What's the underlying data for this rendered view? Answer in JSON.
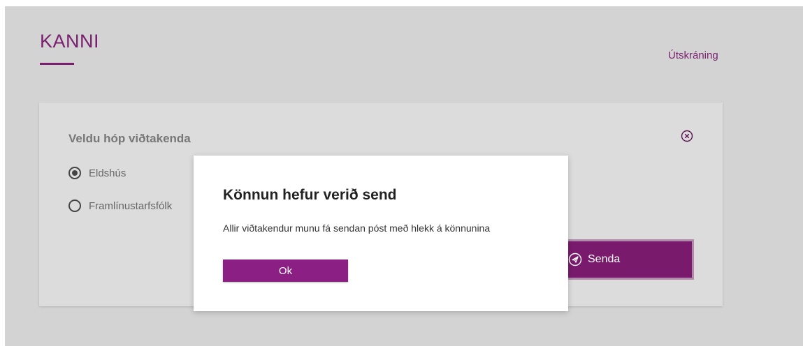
{
  "header": {
    "brand": "KANNI",
    "logout_label": "Útskráning"
  },
  "card": {
    "title": "Veldu hóp viðtakenda",
    "close_icon": "close-circle-icon",
    "options": [
      {
        "label": "Eldshús",
        "checked": true
      },
      {
        "label": "Framlínustarfsfólk",
        "checked": false
      }
    ],
    "send_label": "Senda",
    "send_icon": "paper-plane-icon"
  },
  "modal": {
    "title": "Könnun hefur verið send",
    "body": "Allir viðtakendur munu fá sendan póst með hlekk á könnunina",
    "ok_label": "Ok"
  },
  "colors": {
    "brand": "#7a1f6f",
    "button": "#7a1a6d",
    "ok_button": "#8c1f83",
    "background": "#d3d3d3",
    "card": "#dcdcdc"
  }
}
